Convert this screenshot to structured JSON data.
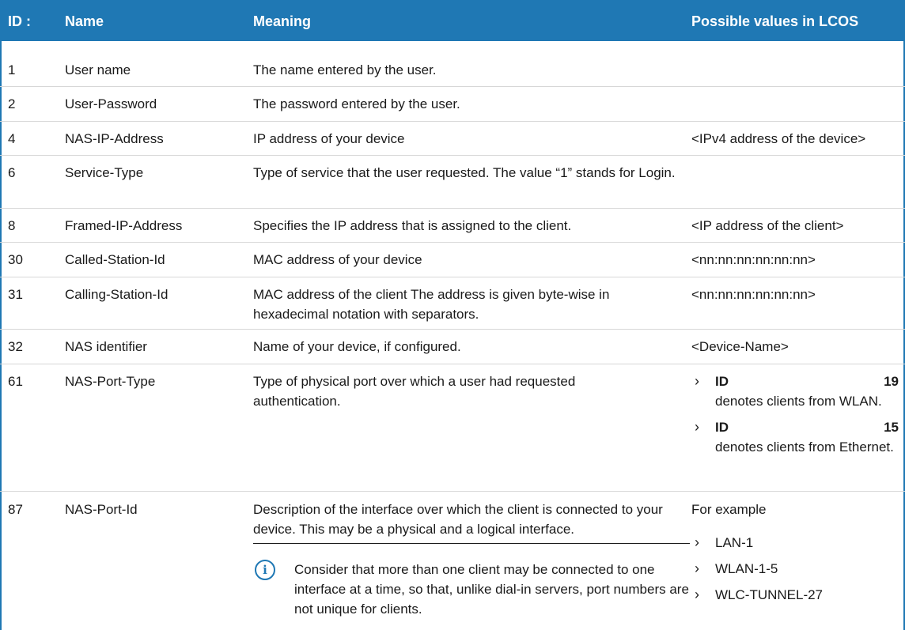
{
  "header": {
    "id": "ID :",
    "name": "Name",
    "meaning": "Meaning",
    "values": "Possible values in LCOS"
  },
  "rows": [
    {
      "id": "1",
      "name": "User name",
      "meaning": "The name entered by the user.",
      "values": ""
    },
    {
      "id": "2",
      "name": "User-Password",
      "meaning": "The password entered by the user.",
      "values": ""
    },
    {
      "id": "4",
      "name": "NAS-IP-Address",
      "meaning": "IP address of your device",
      "values": "<IPv4 address of the device>"
    },
    {
      "id": "6",
      "name": "Service-Type",
      "meaning": "Type of service that the user requested. The value “1” stands for Login.",
      "values": ""
    },
    {
      "id": "8",
      "name": "Framed-IP-Address",
      "meaning": "Specifies the IP address that is assigned to the client.",
      "values": "<IP address of the client>"
    },
    {
      "id": "30",
      "name": "Called-Station-Id",
      "meaning": "MAC address of your device",
      "values": "<nn:nn:nn:nn:nn:nn>"
    },
    {
      "id": "31",
      "name": "Calling-Station-Id",
      "meaning": "MAC address of the client The address is given byte-wise in hexadecimal notation with separators.",
      "values": "<nn:nn:nn:nn:nn:nn>"
    },
    {
      "id": "32",
      "name": "NAS identifier",
      "meaning": "Name of your device, if configured.",
      "values": "<Device-Name>"
    },
    {
      "id": "61",
      "name": "NAS-Port-Type",
      "meaning": "Type of physical port over which a user had requested authentication.",
      "values_list": [
        {
          "bold": "ID 19",
          "text": " denotes clients from WLAN."
        },
        {
          "bold": "ID 15",
          "text": " denotes clients from Ethernet."
        }
      ]
    },
    {
      "id": "87",
      "name": "NAS-Port-Id",
      "meaning": "Description of the interface over which the client is connected to your device. This may be a physical and a logical interface.",
      "values_intro": "For example",
      "values_list": [
        "LAN-1",
        "WLAN-1-5",
        "WLC-TUNNEL-27"
      ],
      "note": "Consider that more than one client may be connected to one interface at a time, so that, unlike dial-in servers, port numbers are not unique for clients."
    }
  ],
  "icons": {
    "bullet": "chevron-right-icon",
    "note": "info-icon"
  },
  "colors": {
    "accent": "#1f78b4"
  }
}
